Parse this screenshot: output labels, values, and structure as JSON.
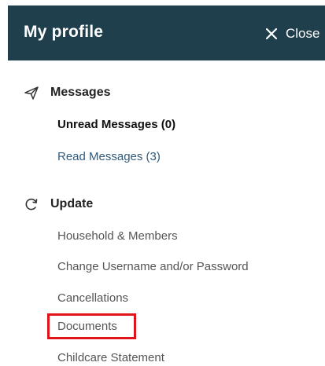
{
  "header": {
    "title": "My profile",
    "close_label": "Close",
    "background": "#1f3f4c"
  },
  "messages": {
    "label": "Messages",
    "icon": "paper-plane-icon",
    "items": [
      "Unread Messages (0)",
      "Read Messages (3)"
    ]
  },
  "update": {
    "label": "Update",
    "icon": "refresh-icon",
    "items": [
      "Household & Members",
      "Change Username and/or Password",
      "Cancellations",
      "Documents",
      "Childcare Statement"
    ]
  },
  "colors": {
    "highlight": "#e0121a",
    "link": "#2f5a7e"
  }
}
